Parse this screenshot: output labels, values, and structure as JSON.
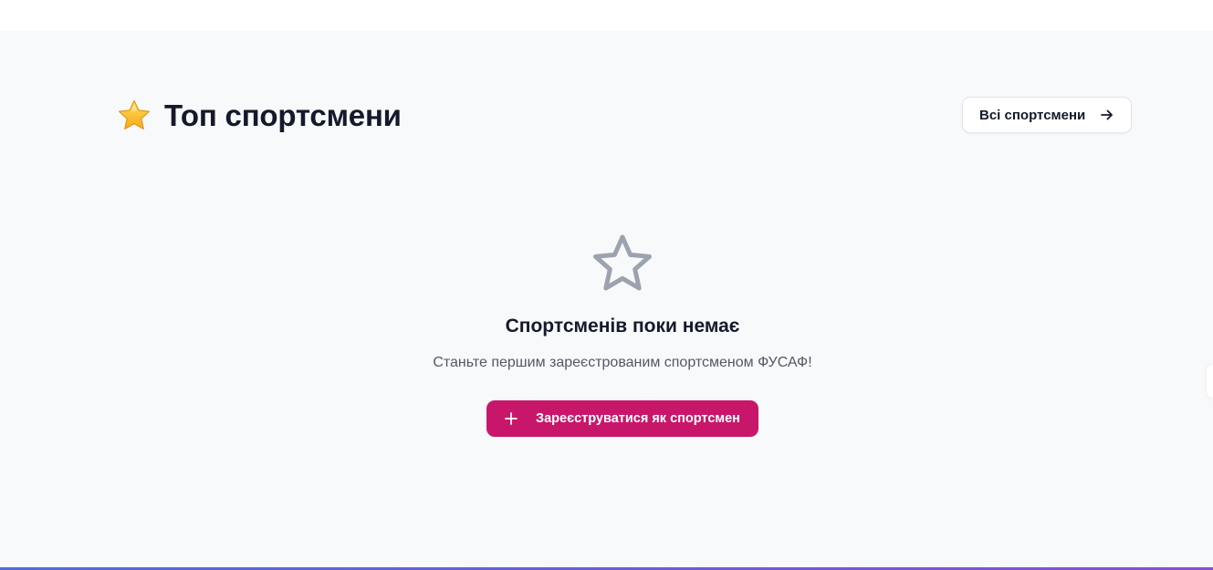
{
  "header": {
    "title_icon": "star-emoji-icon",
    "title": "Топ спортсмени",
    "all_athletes_label": "Всі спортсмени",
    "all_athletes_icon": "arrow-right-icon"
  },
  "empty_state": {
    "icon": "star-outline-icon",
    "title": "Спортсменів поки немає",
    "subtitle": "Станьте першим зареєстрованим спортсменом ФУСАФ!",
    "register_label": "Зареєструватися як спортсмен",
    "register_icon": "plus-icon"
  },
  "colors": {
    "accent": "#c8176b",
    "section_bg": "#f8f9fb",
    "heading": "#141a2b",
    "muted_icon": "#9ca3af",
    "divider_gradient": [
      "#4f6fd9",
      "#8b4fd3"
    ]
  }
}
